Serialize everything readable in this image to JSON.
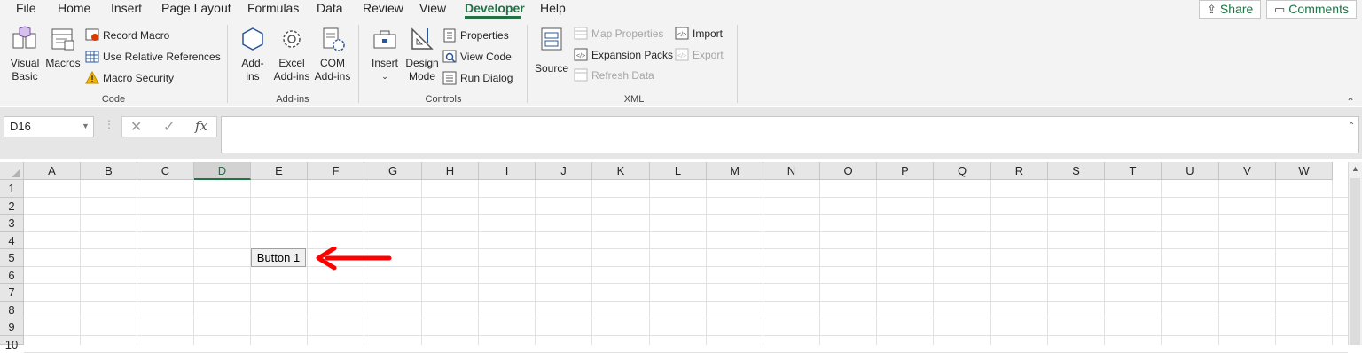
{
  "tabs": [
    "File",
    "Home",
    "Insert",
    "Page Layout",
    "Formulas",
    "Data",
    "Review",
    "View",
    "Developer",
    "Help"
  ],
  "active_tab": "Developer",
  "share_label": "Share",
  "comments_label": "Comments",
  "groups": {
    "code": {
      "label": "Code",
      "visual_basic": [
        "Visual",
        "Basic"
      ],
      "macros": "Macros",
      "record_macro": "Record Macro",
      "relative_refs": "Use Relative References",
      "macro_security": "Macro Security"
    },
    "addins": {
      "label": "Add-ins",
      "addins": [
        "Add-",
        "ins"
      ],
      "excel_addins": [
        "Excel",
        "Add-ins"
      ],
      "com_addins": [
        "COM",
        "Add-ins"
      ]
    },
    "controls": {
      "label": "Controls",
      "insert": "Insert",
      "design_mode": [
        "Design",
        "Mode"
      ],
      "properties": "Properties",
      "view_code": "View Code",
      "run_dialog": "Run Dialog"
    },
    "xml": {
      "label": "XML",
      "source": "Source",
      "map_properties": "Map Properties",
      "expansion_packs": "Expansion Packs",
      "refresh_data": "Refresh Data",
      "import": "Import",
      "export": "Export"
    }
  },
  "formula_bar": {
    "name_box": "D16",
    "fx": "fx",
    "cancel": "✕",
    "enter": "✓",
    "value": ""
  },
  "grid": {
    "columns": [
      "A",
      "B",
      "C",
      "D",
      "E",
      "F",
      "G",
      "H",
      "I",
      "J",
      "K",
      "L",
      "M",
      "N",
      "O",
      "P",
      "Q",
      "R",
      "S",
      "T",
      "U",
      "V",
      "W"
    ],
    "selected_column": "D",
    "rows": [
      "1",
      "2",
      "3",
      "4",
      "5",
      "6",
      "7",
      "8",
      "9",
      "10"
    ],
    "form_button_label": "Button 1"
  },
  "colors": {
    "accent": "#217346",
    "arrow": "#ff0000"
  },
  "icons": [
    "visual-basic-icon",
    "macros-icon",
    "record-macro-icon",
    "relative-references-icon",
    "warning-icon",
    "addins-icon",
    "gear-icon",
    "com-addins-icon",
    "toolbox-icon",
    "design-mode-icon",
    "properties-icon",
    "view-code-icon",
    "run-dialog-icon",
    "source-icon",
    "map-properties-icon",
    "expansion-packs-icon",
    "refresh-data-icon",
    "import-icon",
    "export-icon",
    "share-icon",
    "comments-icon"
  ]
}
